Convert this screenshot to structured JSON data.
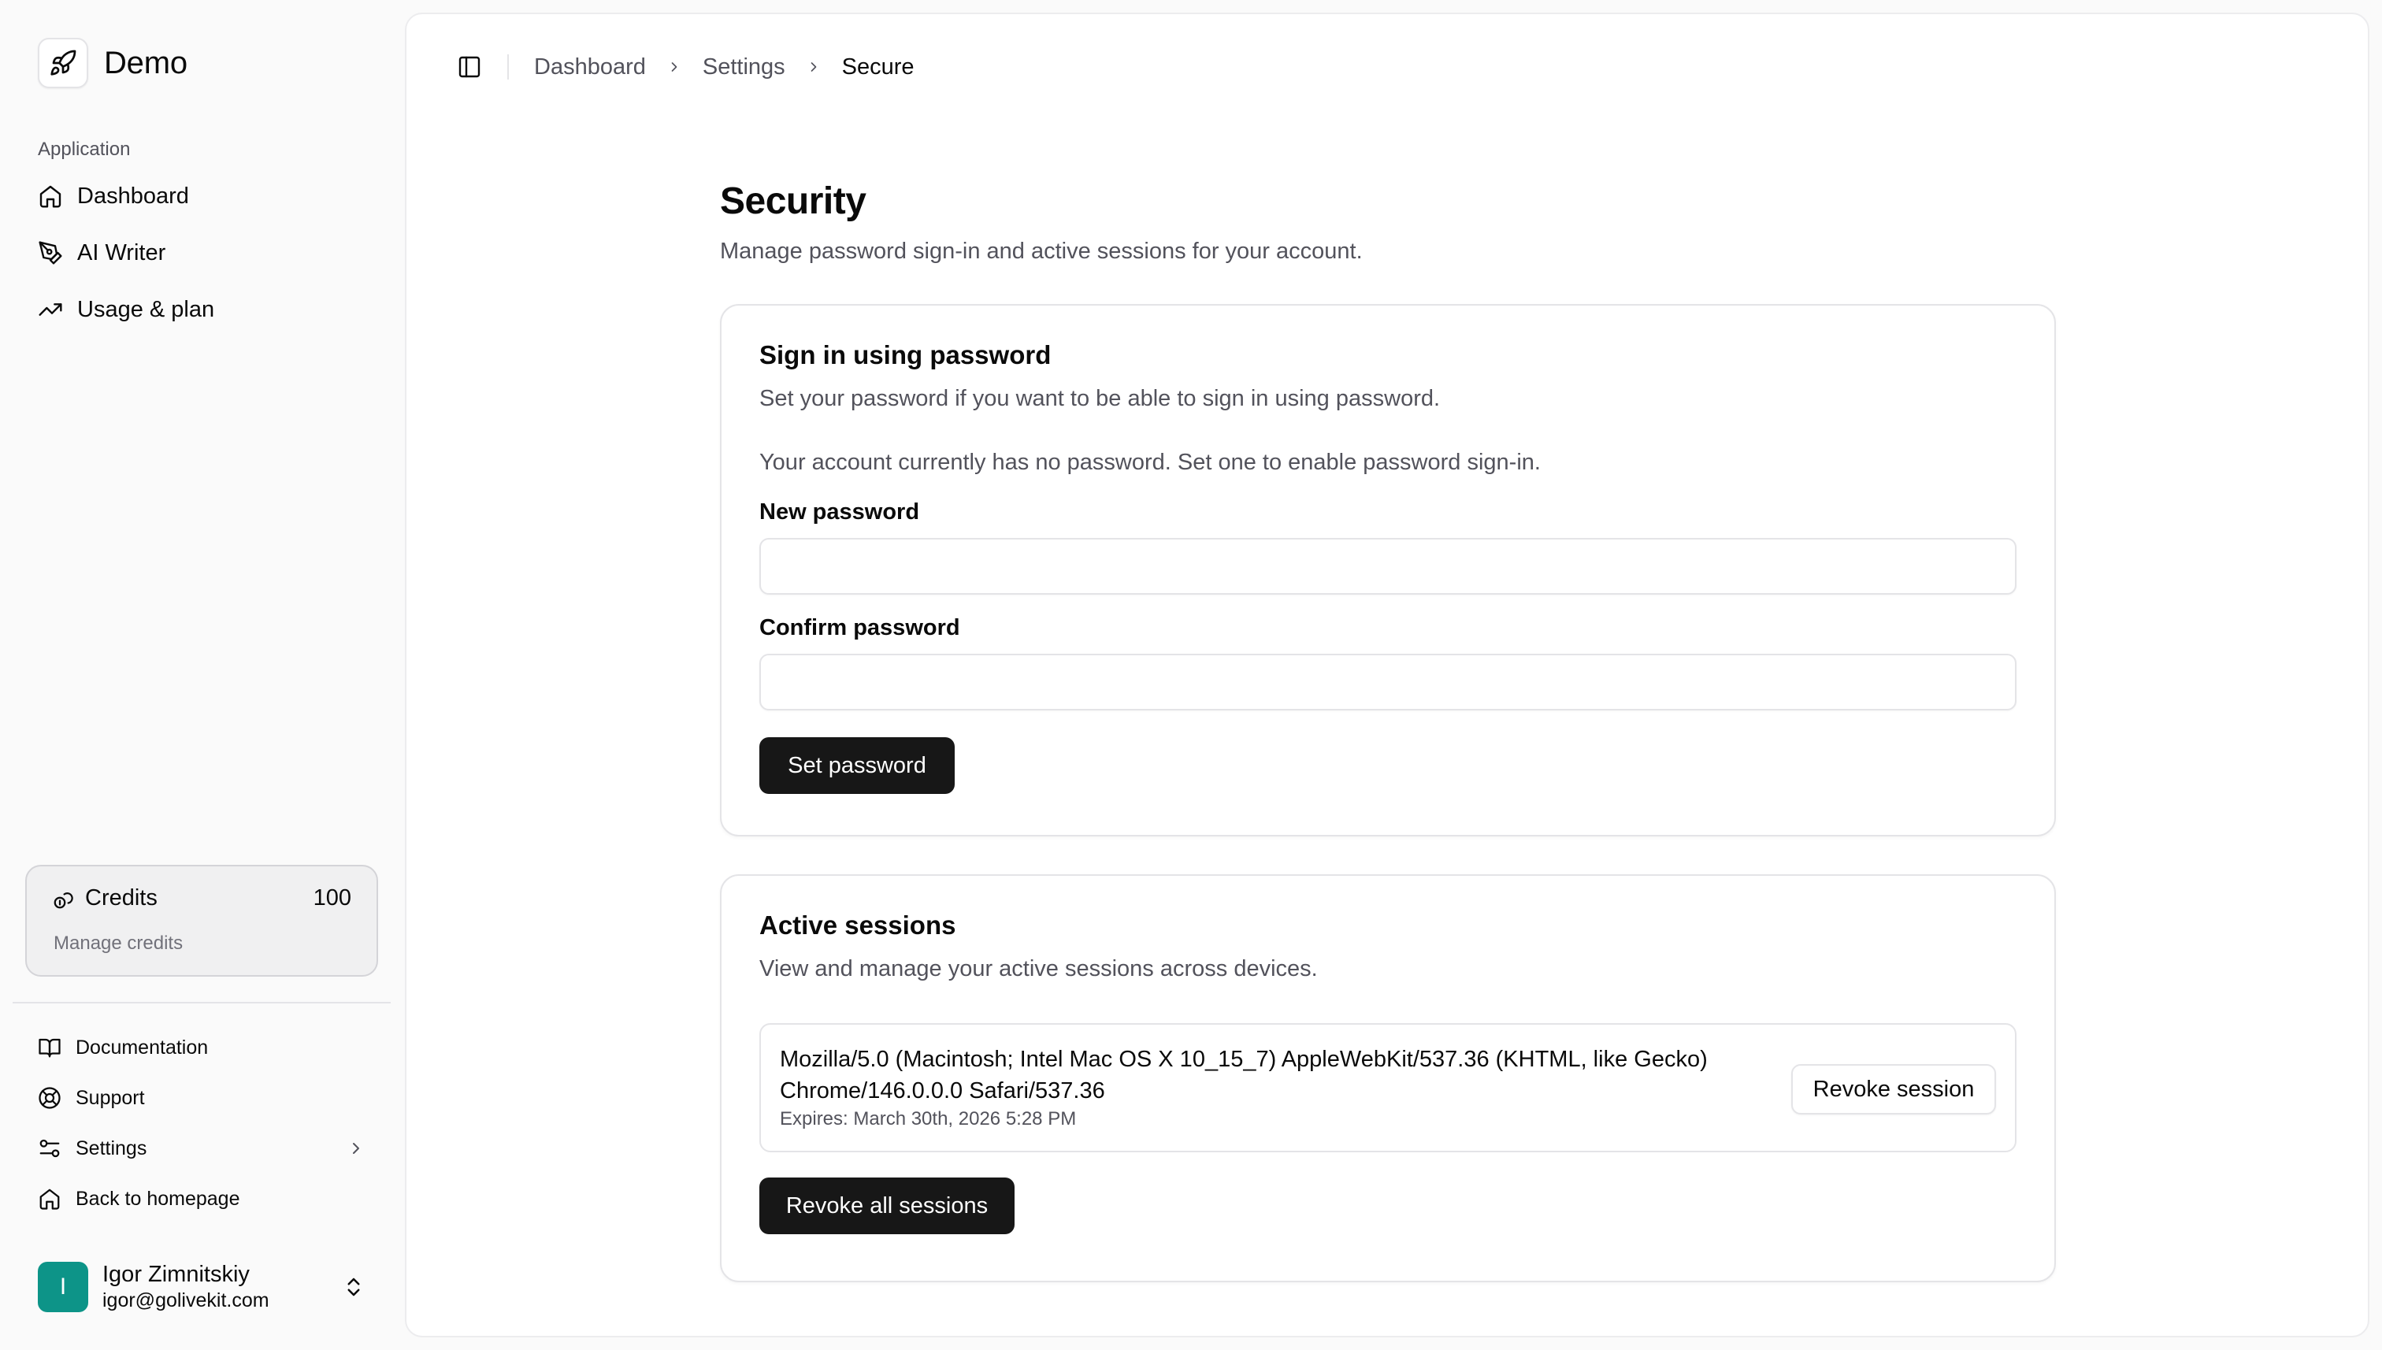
{
  "brand": {
    "name": "Demo",
    "icon": "rocket-icon"
  },
  "sidebar": {
    "section_label": "Application",
    "items": [
      {
        "label": "Dashboard",
        "icon": "home-icon"
      },
      {
        "label": "AI Writer",
        "icon": "pen-tool-icon"
      },
      {
        "label": "Usage & plan",
        "icon": "trending-up-icon"
      }
    ],
    "credits": {
      "title": "Credits",
      "count": "100",
      "subtitle": "Manage credits",
      "icon": "coins-icon"
    },
    "links": [
      {
        "label": "Documentation",
        "icon": "book-open-icon"
      },
      {
        "label": "Support",
        "icon": "life-buoy-icon"
      },
      {
        "label": "Settings",
        "icon": "settings-sliders-icon"
      },
      {
        "label": "Back to homepage",
        "icon": "home-icon"
      }
    ],
    "user": {
      "initial": "I",
      "name": "Igor Zimnitskiy",
      "email": "igor@golivekit.com",
      "avatar_color": "#0d9488"
    }
  },
  "breadcrumb": {
    "items": [
      "Dashboard",
      "Settings"
    ],
    "current": "Secure"
  },
  "page": {
    "title": "Security",
    "subtitle": "Manage password sign-in and active sessions for your account."
  },
  "password_card": {
    "title": "Sign in using password",
    "description": "Set your password if you want to be able to sign in using password.",
    "note": "Your account currently has no password. Set one to enable password sign-in.",
    "new_password_label": "New password",
    "new_password_value": "",
    "confirm_password_label": "Confirm password",
    "confirm_password_value": "",
    "submit_label": "Set password"
  },
  "sessions_card": {
    "title": "Active sessions",
    "description": "View and manage your active sessions across devices.",
    "sessions": [
      {
        "user_agent": "Mozilla/5.0 (Macintosh; Intel Mac OS X 10_15_7) AppleWebKit/537.36 (KHTML, like Gecko) Chrome/146.0.0.0 Safari/537.36",
        "expires": "Expires: March 30th, 2026 5:28 PM",
        "revoke_label": "Revoke session"
      }
    ],
    "revoke_all_label": "Revoke all sessions"
  },
  "colors": {
    "primary_button": "#171717",
    "avatar": "#0d9488",
    "muted_text": "#52525b"
  }
}
